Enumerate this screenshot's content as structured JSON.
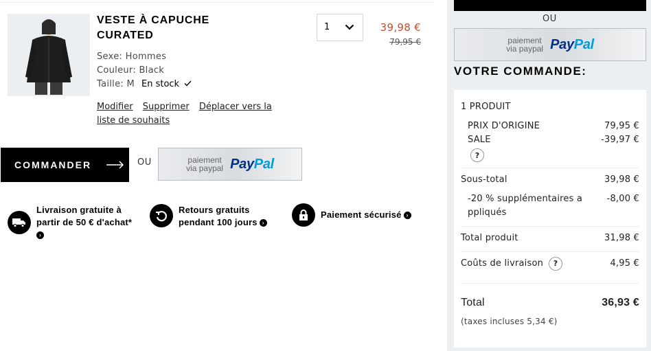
{
  "product": {
    "name": "VESTE À CAPUCHE CURATED",
    "gender": "Sexe: Hommes",
    "color": "Couleur: Black",
    "size": "Taille: M",
    "stock": "En stock",
    "actions": {
      "edit": "Modifier",
      "delete": "Supprimer",
      "move": "Déplacer vers la liste de souhaits"
    },
    "quantity": "1",
    "price_sale": "39,98 €",
    "price_original": "79,95 €"
  },
  "checkout": {
    "label": "COMMANDER",
    "or": "OU"
  },
  "paypal": {
    "line1": "paiement",
    "line2": "via paypal",
    "logo_a": "Pay",
    "logo_b": "Pal"
  },
  "features": [
    {
      "label": "Livraison gratuite à partir de 50 € d'achat*"
    },
    {
      "label": "Retours gratuits pendant 100 jours"
    },
    {
      "label": "Paiement sécurisé"
    }
  ],
  "summary": {
    "or": "OU",
    "title": "VOTRE COMMANDE:",
    "items_count": "1 PRODUIT",
    "original_label": "PRIX D'ORIGINE",
    "original_value": "79,95 €",
    "sale_label": "SALE",
    "sale_value": "-39,97 €",
    "subtotal_label": "Sous-total",
    "subtotal_value": "39,98 €",
    "extra_label": "-20 % supplémentaires appliqués",
    "extra_value": "-8,00 €",
    "product_total_label": "Total produit",
    "product_total_value": "31,98 €",
    "shipping_label": "Coûts de livraison",
    "shipping_value": "4,95 €",
    "total_label": "Total",
    "total_value": "36,93 €",
    "tax_note": "(taxes incluses 5,34 €)"
  },
  "colors": {
    "sale_price": "#c14d32",
    "panel_bg": "#eceff1",
    "paypal_dark": "#003087",
    "paypal_light": "#009cde"
  }
}
